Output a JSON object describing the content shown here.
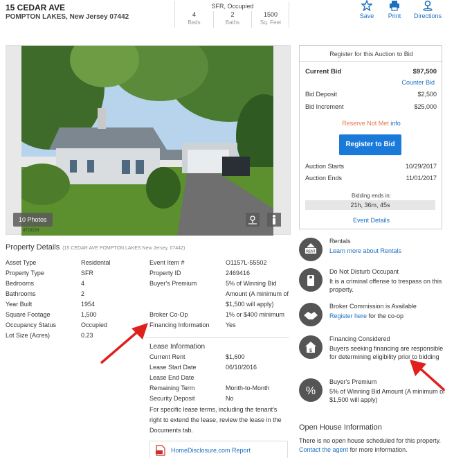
{
  "header": {
    "street": "15 CEDAR AVE",
    "city_line": "POMPTON LAKES, New Jersey 07442",
    "property_type_occupancy": "SFR, Occupied",
    "beds_value": "4",
    "beds_label": "Beds",
    "baths_value": "2",
    "baths_label": "Baths",
    "sqft_value": "1500",
    "sqft_label": "Sq. Feet",
    "save_label": "Save",
    "print_label": "Print",
    "directions_label": "Directions"
  },
  "photo": {
    "count_label": "10 Photos",
    "photo_id": "4723229"
  },
  "bid_panel": {
    "title": "Register for this Auction to Bid",
    "current_bid_label": "Current Bid",
    "current_bid_value": "$97,500",
    "counter_bid_label": "Counter Bid",
    "deposit_label": "Bid Deposit",
    "deposit_value": "$2,500",
    "increment_label": "Bid Increment",
    "increment_value": "$25,000",
    "reserve_text": "Reserve Not Met",
    "info_label": "info",
    "register_button": "Register to Bid",
    "starts_label": "Auction Starts",
    "starts_value": "10/29/2017",
    "ends_label": "Auction Ends",
    "ends_value": "11/01/2017",
    "bidding_ends_label": "Bidding ends in:",
    "countdown": "21h, 36m, 45s",
    "event_details_link": "Event Details"
  },
  "property_details": {
    "title": "Property Details",
    "subtitle": "(15 CEDAR AVE POMPTON LAKES New Jersey, 07442)",
    "left_labels": [
      "Asset Type",
      "Property Type",
      "Bedrooms",
      "Bathrooms",
      "Year Built",
      "Square Footage",
      "Occupancy Status",
      "Lot Size (Acres)"
    ],
    "left_values": [
      "Residental",
      "SFR",
      "4",
      "2",
      "1954",
      "1,500",
      "Occupied",
      "0.23"
    ],
    "right_labels": [
      "Event Item #",
      "Property ID",
      "Buyer's Premium",
      "",
      "",
      "Broker Co-Op",
      "Financing Information"
    ],
    "right_values": [
      "O1157L-55502",
      "2469416",
      "5% of Winning Bid",
      "Amount (A minimum of",
      "$1,500 will apply)",
      "1% or $400 minimum",
      "Yes"
    ]
  },
  "lease": {
    "title": "Lease Information",
    "labels": [
      "Current Rent",
      "Lease Start Date",
      "Lease End Date",
      "Remaining Term",
      "Security Deposit"
    ],
    "values": [
      "$1,600",
      "06/10/2016",
      "",
      "Month-to-Month",
      "No"
    ],
    "note_lines": [
      "For specific lease terms, including the tenant's",
      "right to extend the lease, review the lease in the",
      "Documents tab."
    ],
    "disclosure_link": "HomeDisclosure.com Report"
  },
  "features": {
    "rentals_title": "Rentals",
    "rentals_link": "Learn more about Rentals",
    "rentals_icon_text": "RENT",
    "dnd_title": "Do Not Disturb Occupant",
    "dnd_text": "It is a criminal offense to trespass on this property.",
    "broker_title": "Broker Commission is Available",
    "broker_link": "Register here",
    "broker_text": " for the co-op",
    "financing_title": "Financing Considered",
    "financing_text": "Buyers seeking financing are responsible for determining eligibility prior to bidding",
    "premium_title": "Buyer's Premium",
    "premium_text": "5% of Winning Bid Amount (A minimum of $1,500 will apply)"
  },
  "open_house": {
    "title": "Open House Information",
    "text": "There is no open house scheduled for this property.",
    "contact_link": "Contact the agent",
    "contact_rest": " for more information."
  },
  "colors": {
    "link": "#1a6fc1",
    "button": "#1a7ad9",
    "reserve": "#e8744a",
    "arrow": "#e0201c"
  }
}
